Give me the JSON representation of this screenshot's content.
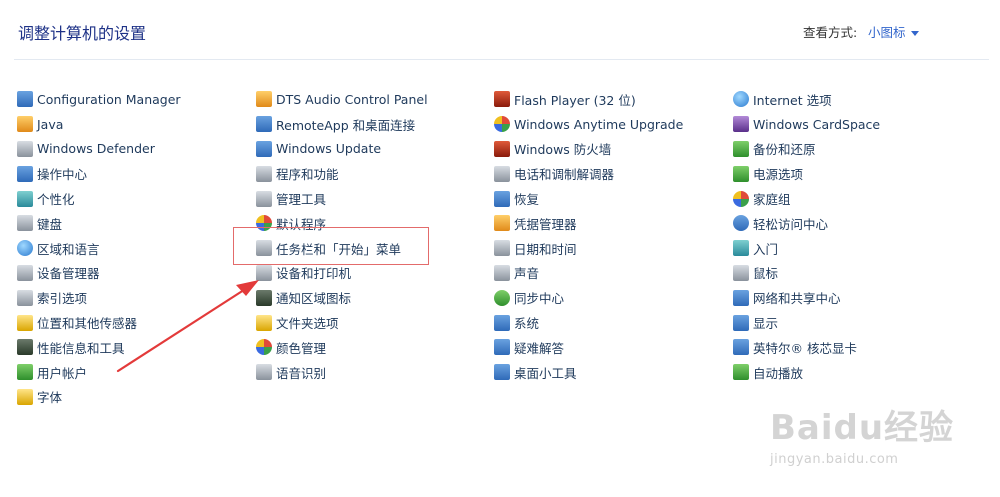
{
  "header": {
    "title": "调整计算机的设置",
    "view_label": "查看方式:",
    "view_value": "小图标"
  },
  "columns": [
    [
      {
        "label": "Configuration Manager",
        "icon": "config-manager-icon"
      },
      {
        "label": "Java",
        "icon": "java-icon"
      },
      {
        "label": "Windows Defender",
        "icon": "defender-icon"
      },
      {
        "label": "操作中心",
        "icon": "flag-icon"
      },
      {
        "label": "个性化",
        "icon": "monitor-icon"
      },
      {
        "label": "键盘",
        "icon": "keyboard-icon"
      },
      {
        "label": "区域和语言",
        "icon": "globe-icon"
      },
      {
        "label": "设备管理器",
        "icon": "device-manager-icon"
      },
      {
        "label": "索引选项",
        "icon": "index-icon"
      },
      {
        "label": "位置和其他传感器",
        "icon": "sensor-icon"
      },
      {
        "label": "性能信息和工具",
        "icon": "performance-icon"
      },
      {
        "label": "用户帐户",
        "icon": "users-icon"
      },
      {
        "label": "字体",
        "icon": "font-folder-icon"
      }
    ],
    [
      {
        "label": "DTS Audio Control Panel",
        "icon": "dts-icon"
      },
      {
        "label": "RemoteApp 和桌面连接",
        "icon": "remoteapp-icon"
      },
      {
        "label": "Windows Update",
        "icon": "windows-update-icon"
      },
      {
        "label": "程序和功能",
        "icon": "programs-icon"
      },
      {
        "label": "管理工具",
        "icon": "admin-tools-icon"
      },
      {
        "label": "默认程序",
        "icon": "default-programs-icon"
      },
      {
        "label": "任务栏和「开始」菜单",
        "icon": "taskbar-icon"
      },
      {
        "label": "设备和打印机",
        "icon": "printer-icon"
      },
      {
        "label": "通知区域图标",
        "icon": "notification-icon"
      },
      {
        "label": "文件夹选项",
        "icon": "folder-icon"
      },
      {
        "label": "颜色管理",
        "icon": "color-icon"
      },
      {
        "label": "语音识别",
        "icon": "microphone-icon"
      }
    ],
    [
      {
        "label": "Flash Player (32 位)",
        "icon": "flash-icon"
      },
      {
        "label": "Windows Anytime Upgrade",
        "icon": "windows-logo-icon"
      },
      {
        "label": "Windows 防火墙",
        "icon": "firewall-icon"
      },
      {
        "label": "电话和调制解调器",
        "icon": "phone-icon"
      },
      {
        "label": "恢复",
        "icon": "recovery-icon"
      },
      {
        "label": "凭据管理器",
        "icon": "credential-icon"
      },
      {
        "label": "日期和时间",
        "icon": "clock-icon"
      },
      {
        "label": "声音",
        "icon": "speaker-icon"
      },
      {
        "label": "同步中心",
        "icon": "sync-icon"
      },
      {
        "label": "系统",
        "icon": "system-icon"
      },
      {
        "label": "疑难解答",
        "icon": "troubleshoot-icon"
      },
      {
        "label": "桌面小工具",
        "icon": "gadgets-icon"
      }
    ],
    [
      {
        "label": "Internet 选项",
        "icon": "internet-icon"
      },
      {
        "label": "Windows CardSpace",
        "icon": "cardspace-icon"
      },
      {
        "label": "备份和还原",
        "icon": "backup-icon"
      },
      {
        "label": "电源选项",
        "icon": "power-icon"
      },
      {
        "label": "家庭组",
        "icon": "homegroup-icon"
      },
      {
        "label": "轻松访问中心",
        "icon": "accessibility-icon"
      },
      {
        "label": "入门",
        "icon": "getting-started-icon"
      },
      {
        "label": "鼠标",
        "icon": "mouse-icon"
      },
      {
        "label": "网络和共享中心",
        "icon": "network-icon"
      },
      {
        "label": "显示",
        "icon": "display-icon"
      },
      {
        "label": "英特尔® 核芯显卡",
        "icon": "intel-graphics-icon"
      },
      {
        "label": "自动播放",
        "icon": "autoplay-icon"
      }
    ]
  ],
  "watermark": {
    "logo": "Baidu经验",
    "url": "jingyan.baidu.com"
  },
  "colors": {
    "title": "#1e3287",
    "link": "#1e395b",
    "highlight": "#e36b6b",
    "arrow": "#e33a3a"
  }
}
